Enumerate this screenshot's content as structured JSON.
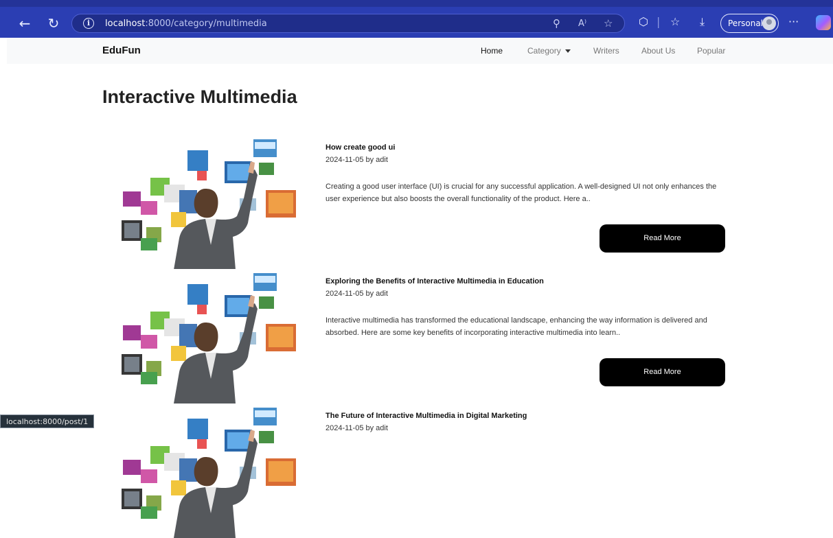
{
  "browser": {
    "url_host": "localhost",
    "url_rest": ":8000/category/multimedia",
    "profile_label": "Personal",
    "status_url": "localhost:8000/post/1"
  },
  "site": {
    "brand": "EduFun",
    "nav": {
      "home": "Home",
      "category": "Category",
      "writers": "Writers",
      "about": "About Us",
      "popular": "Popular"
    }
  },
  "page": {
    "title": "Interactive Multimedia"
  },
  "posts": [
    {
      "title": "How create good ui",
      "meta": "2024-11-05 by adit",
      "excerpt": "Creating a good user interface (UI) is crucial for any successful application. A well-designed UI not only enhances the user experience but also boosts the overall functionality of the product. Here a..",
      "button": "Read More"
    },
    {
      "title": "Exploring the Benefits of Interactive Multimedia in Education",
      "meta": "2024-11-05 by adit",
      "excerpt": "Interactive multimedia has transformed the educational landscape, enhancing the way information is delivered and absorbed. Here are some key benefits of incorporating interactive multimedia into learn..",
      "button": "Read More"
    },
    {
      "title": "The Future of Interactive Multimedia in Digital Marketing",
      "meta": "2024-11-05 by adit",
      "excerpt": "",
      "button": ""
    }
  ],
  "colors": {
    "chrome": "#2b3eb3",
    "button": "#000000",
    "nav_bg": "#f8f9fa"
  }
}
